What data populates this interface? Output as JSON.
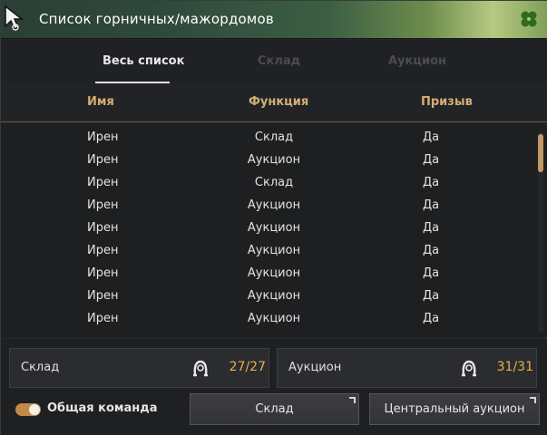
{
  "window": {
    "title": "Список горничных/мажордомов"
  },
  "tabs": [
    {
      "label": "Весь список",
      "active": true
    },
    {
      "label": "Склад",
      "active": false
    },
    {
      "label": "Аукцион",
      "active": false
    }
  ],
  "table": {
    "headers": [
      "Имя",
      "Функция",
      "Призыв"
    ],
    "rows": [
      [
        "Ирен",
        "Склад",
        "Да"
      ],
      [
        "Ирен",
        "Аукцион",
        "Да"
      ],
      [
        "Ирен",
        "Склад",
        "Да"
      ],
      [
        "Ирен",
        "Аукцион",
        "Да"
      ],
      [
        "Ирен",
        "Аукцион",
        "Да"
      ],
      [
        "Ирен",
        "Аукцион",
        "Да"
      ],
      [
        "Ирен",
        "Аукцион",
        "Да"
      ],
      [
        "Ирен",
        "Аукцион",
        "Да"
      ],
      [
        "Ирен",
        "Аукцион",
        "Да"
      ]
    ]
  },
  "summary": {
    "storage": {
      "label": "Склад",
      "count": "27/27"
    },
    "auction": {
      "label": "Аукцион",
      "count": "31/31"
    }
  },
  "footer": {
    "toggle_label": "Общая команда",
    "toggle_on": true,
    "storage_button": "Склад",
    "auction_button": "Центральный аукцион"
  },
  "colors": {
    "accent_gold": "#d3ae74",
    "count_yellow": "#e5b24a",
    "toggle_orange": "#c08a4a"
  },
  "icons": {
    "title_cursor": "cursor-icon",
    "title_clover": "clover-icon",
    "maid": "maid-icon",
    "button_corner": "popout-icon"
  }
}
